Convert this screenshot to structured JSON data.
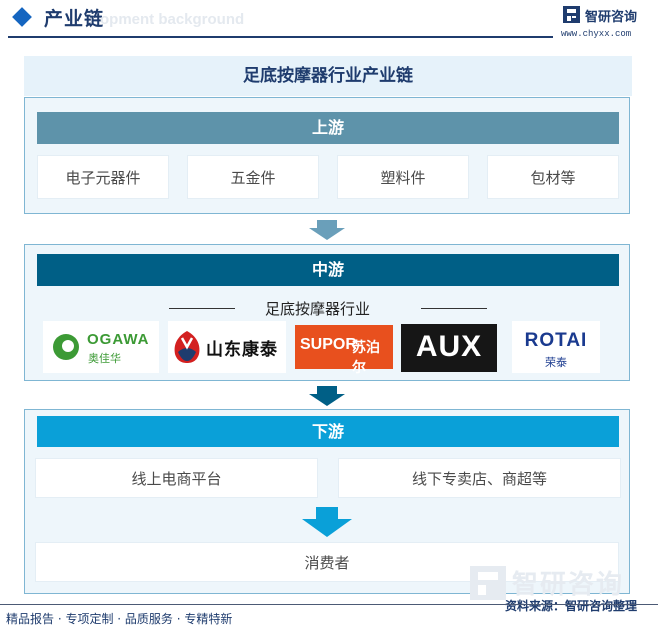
{
  "header": {
    "title": "产业链",
    "bg_text": "opment background",
    "logo_name": "智研咨询",
    "logo_url": "www.chyxx.com"
  },
  "diagram": {
    "title": "足底按摩器行业产业链",
    "upstream": {
      "label": "上游",
      "items": [
        "电子元器件",
        "五金件",
        "塑料件",
        "包材等"
      ]
    },
    "midstream": {
      "label": "中游",
      "industry_label": "足底按摩器行业",
      "brands": [
        {
          "name": "OGAWA",
          "sub": "奥佳华"
        },
        {
          "name": "山东康泰"
        },
        {
          "name": "SUPOR",
          "sub": "苏泊尔"
        },
        {
          "name": "AUX"
        },
        {
          "name": "ROTAI",
          "sub": "荣泰"
        }
      ]
    },
    "downstream": {
      "label": "下游",
      "channels": [
        "线上电商平台",
        "线下专卖店、商超等"
      ],
      "consumer": "消费者"
    }
  },
  "footer": {
    "tagline": "精品报告 · 专项定制 · 品质服务 · 专精特新",
    "source": "资料来源：智研咨询整理",
    "watermark": "智研咨询"
  },
  "colors": {
    "upstream_bar": "#5e93aa",
    "midstream_bar": "#005f86",
    "downstream_bar": "#0aa0d8",
    "arrow_up": "#6a9fba",
    "arrow_mid": "#005f86",
    "arrow_down": "#0aa0d8",
    "navy": "#1f3c6e"
  }
}
